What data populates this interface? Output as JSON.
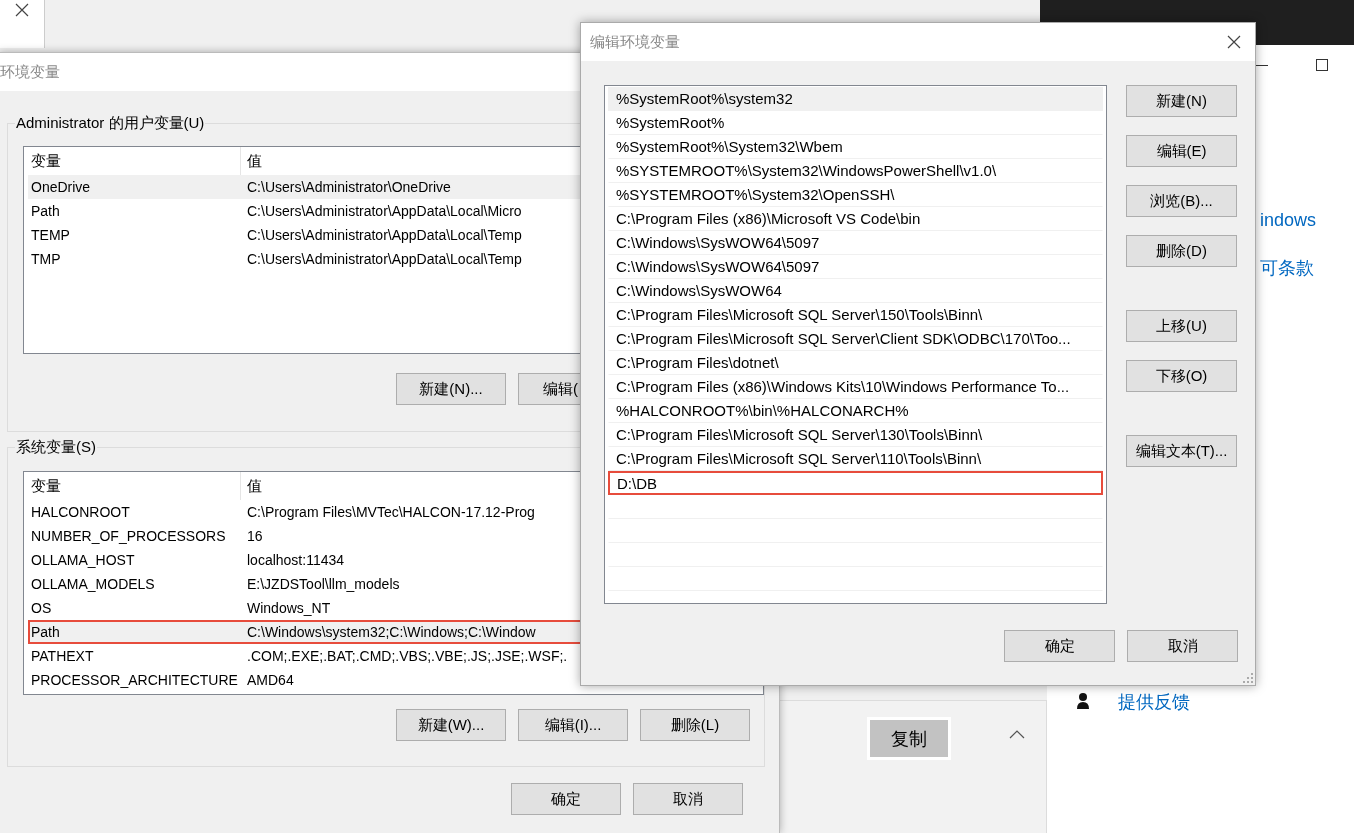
{
  "back_window": {
    "link_1": "indows",
    "link_2": "可条款",
    "feedback_link": "提供反馈",
    "copy_button": "复制"
  },
  "env_dialog": {
    "title": "环境变量",
    "user_group": {
      "label": "Administrator 的用户变量(U)",
      "columns": [
        "变量",
        "值"
      ],
      "rows": [
        {
          "name": "OneDrive",
          "value": "C:\\Users\\Administrator\\OneDrive",
          "selected": true,
          "marked": false
        },
        {
          "name": "Path",
          "value": "C:\\Users\\Administrator\\AppData\\Local\\Micro",
          "selected": false,
          "marked": false
        },
        {
          "name": "TEMP",
          "value": "C:\\Users\\Administrator\\AppData\\Local\\Temp",
          "selected": false,
          "marked": false
        },
        {
          "name": "TMP",
          "value": "C:\\Users\\Administrator\\AppData\\Local\\Temp",
          "selected": false,
          "marked": false
        }
      ],
      "buttons": [
        "新建(N)...",
        "编辑("
      ]
    },
    "system_group": {
      "label": "系统变量(S)",
      "columns": [
        "变量",
        "值"
      ],
      "rows": [
        {
          "name": "HALCONROOT",
          "value": "C:\\Program Files\\MVTec\\HALCON-17.12-Prog",
          "selected": false,
          "marked": false
        },
        {
          "name": "NUMBER_OF_PROCESSORS",
          "value": "16",
          "selected": false,
          "marked": false
        },
        {
          "name": "OLLAMA_HOST",
          "value": "localhost:11434",
          "selected": false,
          "marked": false
        },
        {
          "name": "OLLAMA_MODELS",
          "value": "E:\\JZDSTool\\llm_models",
          "selected": false,
          "marked": false
        },
        {
          "name": "OS",
          "value": "Windows_NT",
          "selected": false,
          "marked": false
        },
        {
          "name": "Path",
          "value": "C:\\Windows\\system32;C:\\Windows;C:\\Window",
          "selected": true,
          "marked": true
        },
        {
          "name": "PATHEXT",
          "value": ".COM;.EXE;.BAT;.CMD;.VBS;.VBE;.JS;.JSE;.WSF;.",
          "selected": false,
          "marked": false
        },
        {
          "name": "PROCESSOR_ARCHITECTURE",
          "value": "AMD64",
          "selected": false,
          "marked": false
        }
      ],
      "buttons": [
        "新建(W)...",
        "编辑(I)...",
        "删除(L)"
      ]
    },
    "buttons": [
      "确定",
      "取消"
    ]
  },
  "edit_dialog": {
    "title": "编辑环境变量",
    "entries": [
      {
        "text": "%SystemRoot%\\system32",
        "selected": true,
        "marked": false
      },
      {
        "text": "%SystemRoot%",
        "selected": false,
        "marked": false
      },
      {
        "text": "%SystemRoot%\\System32\\Wbem",
        "selected": false,
        "marked": false
      },
      {
        "text": "%SYSTEMROOT%\\System32\\WindowsPowerShell\\v1.0\\",
        "selected": false,
        "marked": false
      },
      {
        "text": "%SYSTEMROOT%\\System32\\OpenSSH\\",
        "selected": false,
        "marked": false
      },
      {
        "text": "C:\\Program Files (x86)\\Microsoft VS Code\\bin",
        "selected": false,
        "marked": false
      },
      {
        "text": "C:\\Windows\\SysWOW64\\5097",
        "selected": false,
        "marked": false
      },
      {
        "text": "C:\\Windows\\SysWOW64\\5097",
        "selected": false,
        "marked": false
      },
      {
        "text": "C:\\Windows\\SysWOW64",
        "selected": false,
        "marked": false
      },
      {
        "text": "C:\\Program Files\\Microsoft SQL Server\\150\\Tools\\Binn\\",
        "selected": false,
        "marked": false
      },
      {
        "text": "C:\\Program Files\\Microsoft SQL Server\\Client SDK\\ODBC\\170\\Too...",
        "selected": false,
        "marked": false
      },
      {
        "text": "C:\\Program Files\\dotnet\\",
        "selected": false,
        "marked": false
      },
      {
        "text": "C:\\Program Files (x86)\\Windows Kits\\10\\Windows Performance To...",
        "selected": false,
        "marked": false
      },
      {
        "text": "%HALCONROOT%\\bin\\%HALCONARCH%",
        "selected": false,
        "marked": false
      },
      {
        "text": "C:\\Program Files\\Microsoft SQL Server\\130\\Tools\\Binn\\",
        "selected": false,
        "marked": false
      },
      {
        "text": "C:\\Program Files\\Microsoft SQL Server\\110\\Tools\\Binn\\",
        "selected": false,
        "marked": false
      },
      {
        "text": "D:\\DB",
        "selected": false,
        "marked": true
      }
    ],
    "button_groups": [
      [
        "新建(N)",
        "编辑(E)",
        "浏览(B)...",
        "删除(D)"
      ],
      [
        "上移(U)",
        "下移(O)"
      ],
      [
        "编辑文本(T)..."
      ]
    ],
    "buttons": [
      "确定",
      "取消"
    ]
  }
}
